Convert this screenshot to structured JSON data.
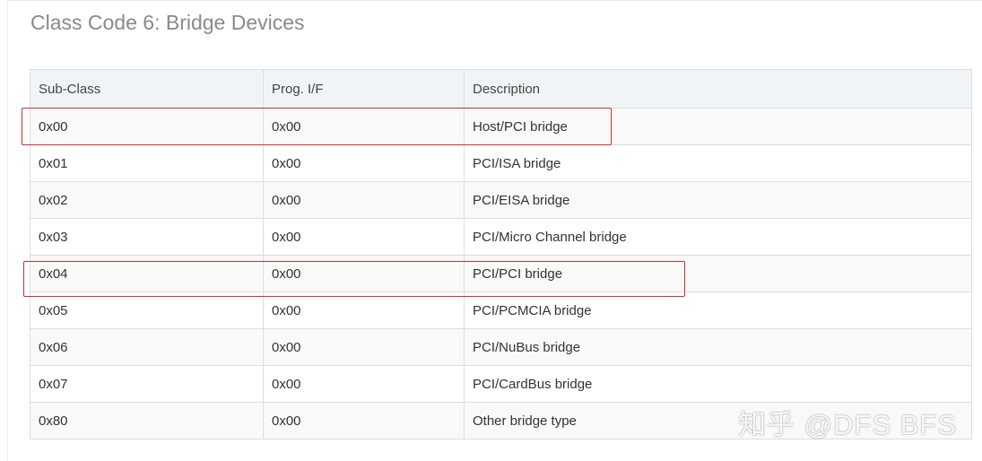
{
  "heading": "Class Code 6: Bridge Devices",
  "table": {
    "columns": [
      "Sub-Class",
      "Prog. I/F",
      "Description"
    ],
    "rows": [
      [
        "0x00",
        "0x00",
        "Host/PCI bridge"
      ],
      [
        "0x01",
        "0x00",
        "PCI/ISA bridge"
      ],
      [
        "0x02",
        "0x00",
        "PCI/EISA bridge"
      ],
      [
        "0x03",
        "0x00",
        "PCI/Micro Channel bridge"
      ],
      [
        "0x04",
        "0x00",
        "PCI/PCI bridge"
      ],
      [
        "0x05",
        "0x00",
        "PCI/PCMCIA bridge"
      ],
      [
        "0x06",
        "0x00",
        "PCI/NuBus bridge"
      ],
      [
        "0x07",
        "0x00",
        "PCI/CardBus bridge"
      ],
      [
        "0x80",
        "0x00",
        "Other bridge type"
      ]
    ]
  },
  "watermark": "知乎 @DFS BFS",
  "colors": {
    "heading": "#8a8a8a",
    "header_bg": "#f1f4f7",
    "stripe_bg": "#f9f9f9",
    "border": "#dddddd",
    "highlight": "#c8332e"
  }
}
